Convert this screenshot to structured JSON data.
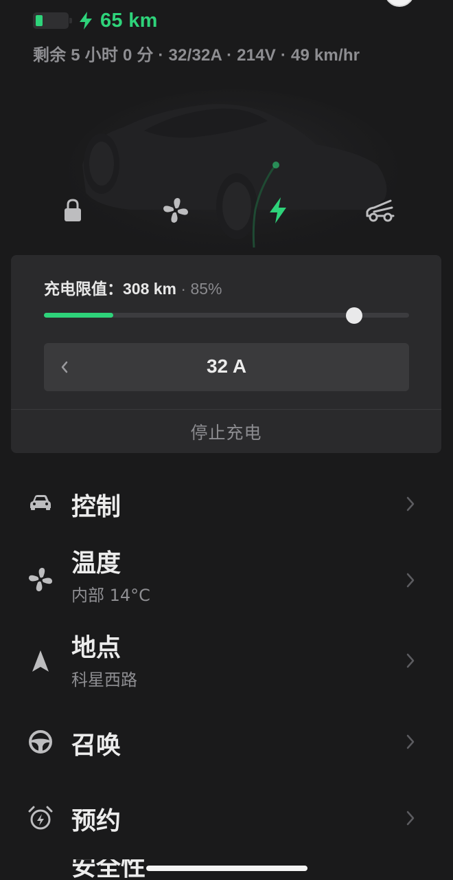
{
  "header": {
    "range": "65 km",
    "battery_level_fraction": 0.22,
    "status_line": "剩余 5 小时 0 分 · 32/32A · 214V · 49 km/hr"
  },
  "quick_actions": [
    {
      "name": "lock-icon"
    },
    {
      "name": "fan-icon"
    },
    {
      "name": "charge-bolt-icon"
    },
    {
      "name": "frunk-icon"
    }
  ],
  "charge_card": {
    "limit_label": "充电限值：",
    "limit_range": "308 km",
    "limit_sep": " · ",
    "limit_percent": "85%",
    "limit_fraction": 0.85,
    "current_charge_fraction": 0.19,
    "amps": "32 A",
    "stop_label": "停止充电"
  },
  "menu": {
    "controls": {
      "title": "控制",
      "icon": "car-icon"
    },
    "climate": {
      "title": "温度",
      "subtitle": "内部 14°C",
      "icon": "fan-icon"
    },
    "location": {
      "title": "地点",
      "subtitle": "科星西路",
      "icon": "location-arrow-icon"
    },
    "summon": {
      "title": "召唤",
      "icon": "steering-wheel-icon"
    },
    "schedule": {
      "title": "预约",
      "icon": "alarm-clock-icon"
    },
    "security": {
      "title": "安全性",
      "icon": "shield-icon"
    }
  },
  "colors": {
    "accent_green": "#2ed37a",
    "background": "#1a1a1b",
    "card": "#2a2a2c"
  }
}
